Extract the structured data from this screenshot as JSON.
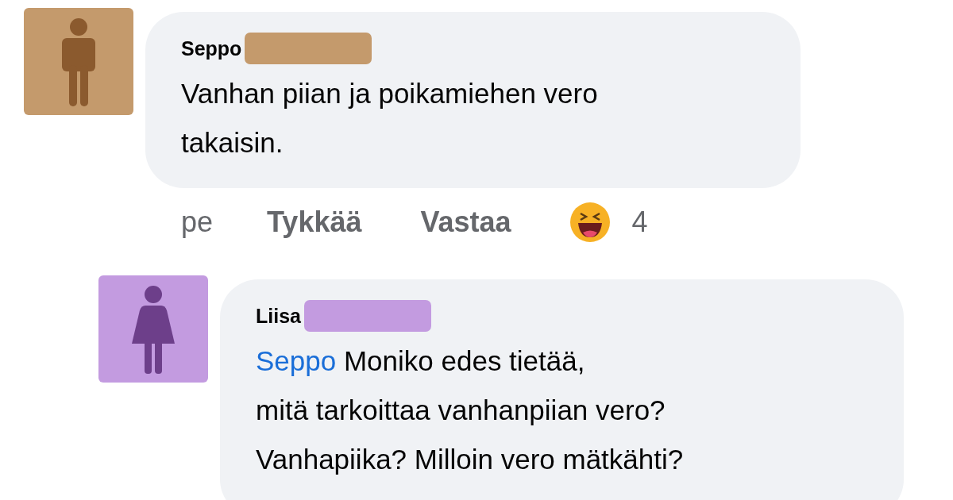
{
  "comments": [
    {
      "author": "Seppo",
      "kind": "male",
      "color": "#c49a6c",
      "lines": [
        "Vanhan piian ja poikamiehen vero",
        "takaisin."
      ],
      "time": "pe",
      "actions": [
        "Tykkää",
        "Vastaa"
      ],
      "reaction_count": "4",
      "children": [
        {
          "author": "Liisa",
          "kind": "female",
          "color": "#c39be0",
          "mention": "Seppo",
          "lines": [
            "Moniko edes tietää,",
            "mitä tarkoittaa vanhanpiian vero?",
            "Vanhapiika? Milloin vero mätkähti?"
          ]
        }
      ]
    }
  ]
}
